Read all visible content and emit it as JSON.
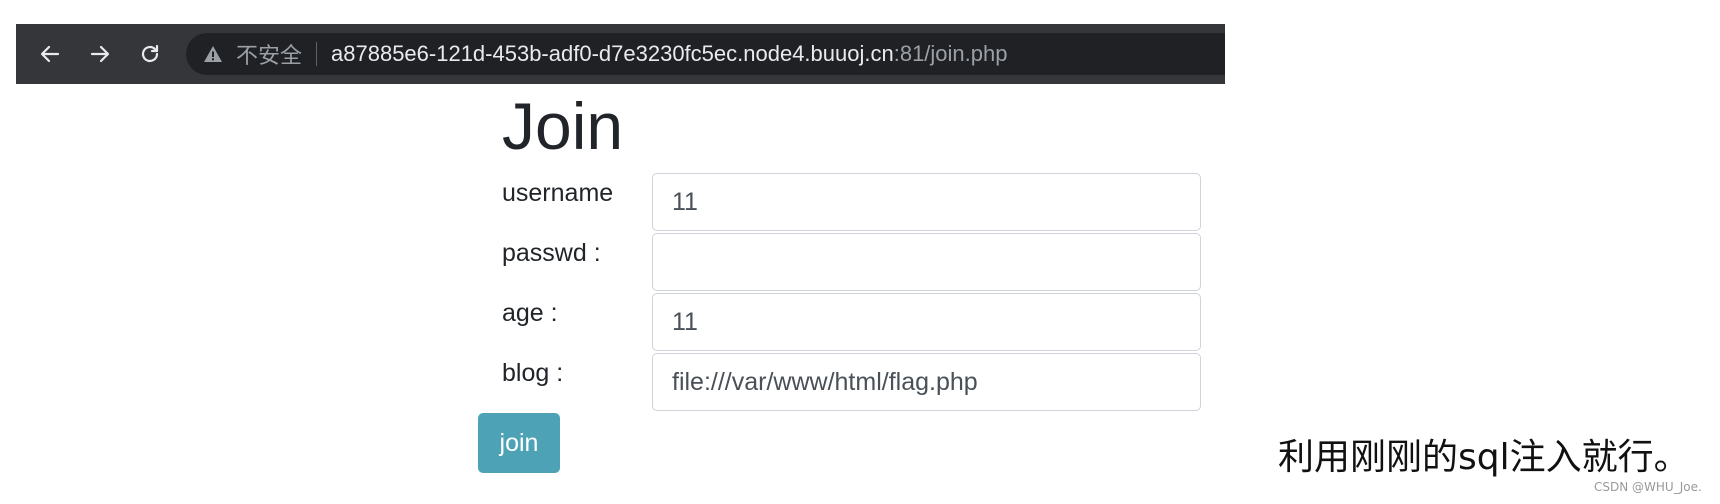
{
  "browser": {
    "back_icon": "arrow-left-icon",
    "forward_icon": "arrow-right-icon",
    "reload_icon": "reload-icon",
    "security_icon": "warning-triangle-icon",
    "security_label": "不安全",
    "url_host": "a87885e6-121d-453b-adf0-d7e3230fc5ec.node4.buuoj.cn",
    "url_rest": ":81/join.php"
  },
  "page": {
    "title": "Join",
    "fields": {
      "username": {
        "label": "username",
        "value": "11"
      },
      "passwd": {
        "label": "passwd :",
        "value": ""
      },
      "age": {
        "label": "age :",
        "value": "11"
      },
      "blog": {
        "label": "blog :",
        "value": "file:///var/www/html/flag.php"
      }
    },
    "submit_label": "join"
  },
  "annotation": {
    "note": "利用刚刚的sql注入就行。",
    "watermark": "CSDN @WHU_Joe."
  },
  "colors": {
    "toolbar": "#35363a",
    "omnibox": "#202124",
    "button": "#4da3b5",
    "input_border": "#ced4da"
  }
}
